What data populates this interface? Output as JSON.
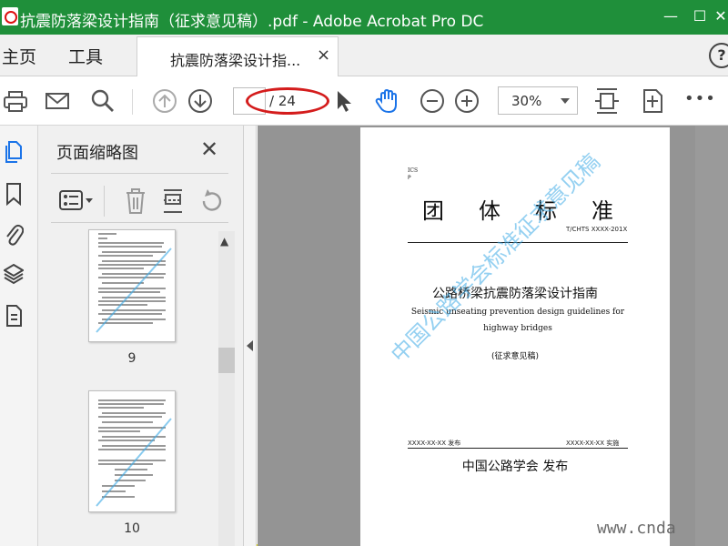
{
  "window": {
    "title": "抗震防落梁设计指南（征求意见稿）.pdf - Adobe Acrobat Pro DC",
    "min_glyph": "—",
    "max_glyph": "☐",
    "close_glyph": "✕"
  },
  "tabs": {
    "home": "主页",
    "tools": "工具",
    "document": "抗震防落梁设计指...",
    "close_glyph": "×",
    "help_glyph": "?"
  },
  "toolbar": {
    "page_current": "",
    "page_total": "/ 24",
    "zoom": "30%",
    "more_glyph": "•••"
  },
  "thumbnails": {
    "panel_title": "页面缩略图",
    "close_glyph": "✕",
    "pages": [
      {
        "number": "9"
      },
      {
        "number": "10"
      }
    ]
  },
  "document_page": {
    "ics": "ICS",
    "p": "P",
    "heading_chars": [
      "团",
      "体",
      "标",
      "准"
    ],
    "standard_code": "T/CHTS XXXX-201X",
    "title_cn": "公路桥梁抗震防落梁设计指南",
    "title_en": "Seismic unseating prevention design guidelines for highway bridges",
    "draft": "(征求意见稿)",
    "publish_date": "XXXX-XX-XX 发布",
    "implement_date": "XXXX-XX-XX 实施",
    "publisher": "中国公路学会  发布"
  },
  "watermarks": {
    "diagonal": "中国公路学会标准征求意见稿",
    "site": "www.cnda"
  },
  "colors": {
    "titlebar": "#1f8f3a",
    "accent_blue": "#1a73e8",
    "annotation_red": "#d41c1c",
    "watermark_blue": "#3caae6"
  }
}
